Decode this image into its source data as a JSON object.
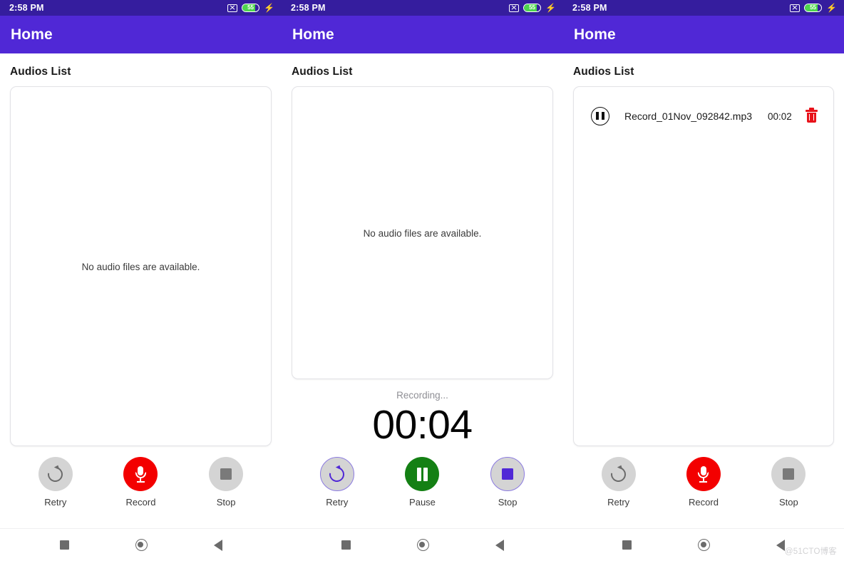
{
  "statusbar": {
    "time": "2:58 PM",
    "battery_level": "55",
    "icons": [
      "mute-x-icon",
      "battery-icon",
      "charging-bolt-icon"
    ]
  },
  "appbar": {
    "title": "Home"
  },
  "section": {
    "title": "Audios List"
  },
  "empty_message": "No audio files are available.",
  "panels": [
    {
      "id": "panel-idle-empty",
      "state": "idle",
      "list_empty": true,
      "controls": [
        {
          "label": "Retry",
          "icon": "refresh-icon",
          "style": "gray"
        },
        {
          "label": "Record",
          "icon": "microphone-icon",
          "style": "red"
        },
        {
          "label": "Stop",
          "icon": "stop-square-icon",
          "style": "gray"
        }
      ]
    },
    {
      "id": "panel-recording",
      "state": "recording",
      "list_empty": true,
      "status_text": "Recording...",
      "timer": "00:04",
      "controls": [
        {
          "label": "Retry",
          "icon": "refresh-icon",
          "style": "gray-purple-border"
        },
        {
          "label": "Pause",
          "icon": "pause-icon",
          "style": "green"
        },
        {
          "label": "Stop",
          "icon": "stop-square-icon",
          "style": "gray-purple-border"
        }
      ]
    },
    {
      "id": "panel-with-recording",
      "state": "idle",
      "list_empty": false,
      "items": [
        {
          "play_icon": "pause-circle-icon",
          "name": "Record_01Nov_092842.mp3",
          "duration": "00:02",
          "delete_icon": "trash-icon"
        }
      ],
      "controls": [
        {
          "label": "Retry",
          "icon": "refresh-icon",
          "style": "gray"
        },
        {
          "label": "Record",
          "icon": "microphone-icon",
          "style": "red"
        },
        {
          "label": "Stop",
          "icon": "stop-square-icon",
          "style": "gray"
        }
      ]
    }
  ],
  "navbar": {
    "items": [
      {
        "name": "recents-icon"
      },
      {
        "name": "home-icon"
      },
      {
        "name": "back-icon"
      }
    ]
  },
  "watermark": "@51CTO博客",
  "colors": {
    "statusbar_bg": "#351d9e",
    "appbar_bg": "#5028d6",
    "record_red": "#f30000",
    "pause_green": "#148014",
    "accent_purple": "#5028d6",
    "trash_red": "#e8121a",
    "battery_green": "#4dd54d"
  }
}
